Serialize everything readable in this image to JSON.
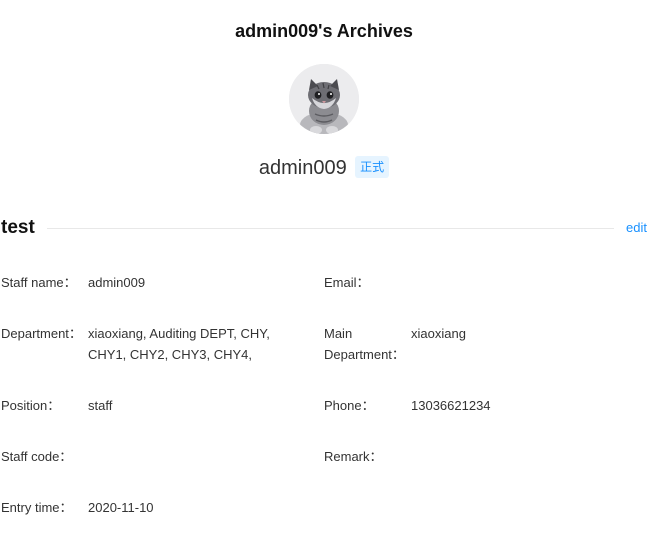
{
  "header": {
    "title": "admin009's Archives"
  },
  "profile": {
    "username": "admin009",
    "status": "正式",
    "avatar_icon": "kitten-avatar"
  },
  "section": {
    "title": "test",
    "edit_label": "edit"
  },
  "fields": {
    "staff_name": {
      "label": "Staff name：",
      "value": "admin009"
    },
    "email": {
      "label": "Email：",
      "value": ""
    },
    "department": {
      "label": "Department：",
      "value": "xiaoxiang, Auditing DEPT, CHY, CHY1, CHY2, CHY3, CHY4,"
    },
    "main_department": {
      "label": "Main Department：",
      "value": "xiaoxiang"
    },
    "position": {
      "label": "Position：",
      "value": "staff"
    },
    "phone": {
      "label": "Phone：",
      "value": "13036621234"
    },
    "staff_code": {
      "label": "Staff code：",
      "value": ""
    },
    "remark": {
      "label": "Remark：",
      "value": ""
    },
    "entry_time": {
      "label": "Entry time：",
      "value": "2020-11-10"
    }
  },
  "colors": {
    "accent": "#1890ff",
    "badge_bg": "#e6f4ff",
    "divider": "#e8e8e8"
  }
}
